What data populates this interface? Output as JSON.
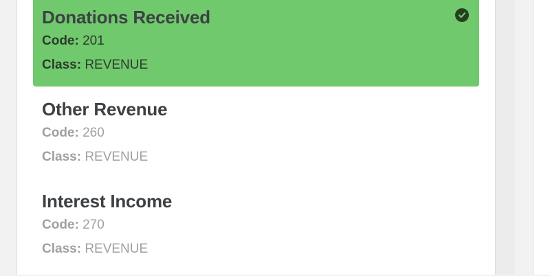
{
  "accounts": [
    {
      "name": "Donations Received",
      "code_label": "Code:",
      "code": "201",
      "class_label": "Class:",
      "class": "REVENUE",
      "selected": true
    },
    {
      "name": "Other Revenue",
      "code_label": "Code:",
      "code": "260",
      "class_label": "Class:",
      "class": "REVENUE",
      "selected": false
    },
    {
      "name": "Interest Income",
      "code_label": "Code:",
      "code": "270",
      "class_label": "Class:",
      "class": "REVENUE",
      "selected": false
    }
  ],
  "colors": {
    "selected_bg": "#70c96c",
    "title": "#3d4144",
    "muted": "#a0a0a0",
    "check_icon": "#25401f"
  },
  "icons": {
    "selected_marker": "check-circle-icon"
  }
}
